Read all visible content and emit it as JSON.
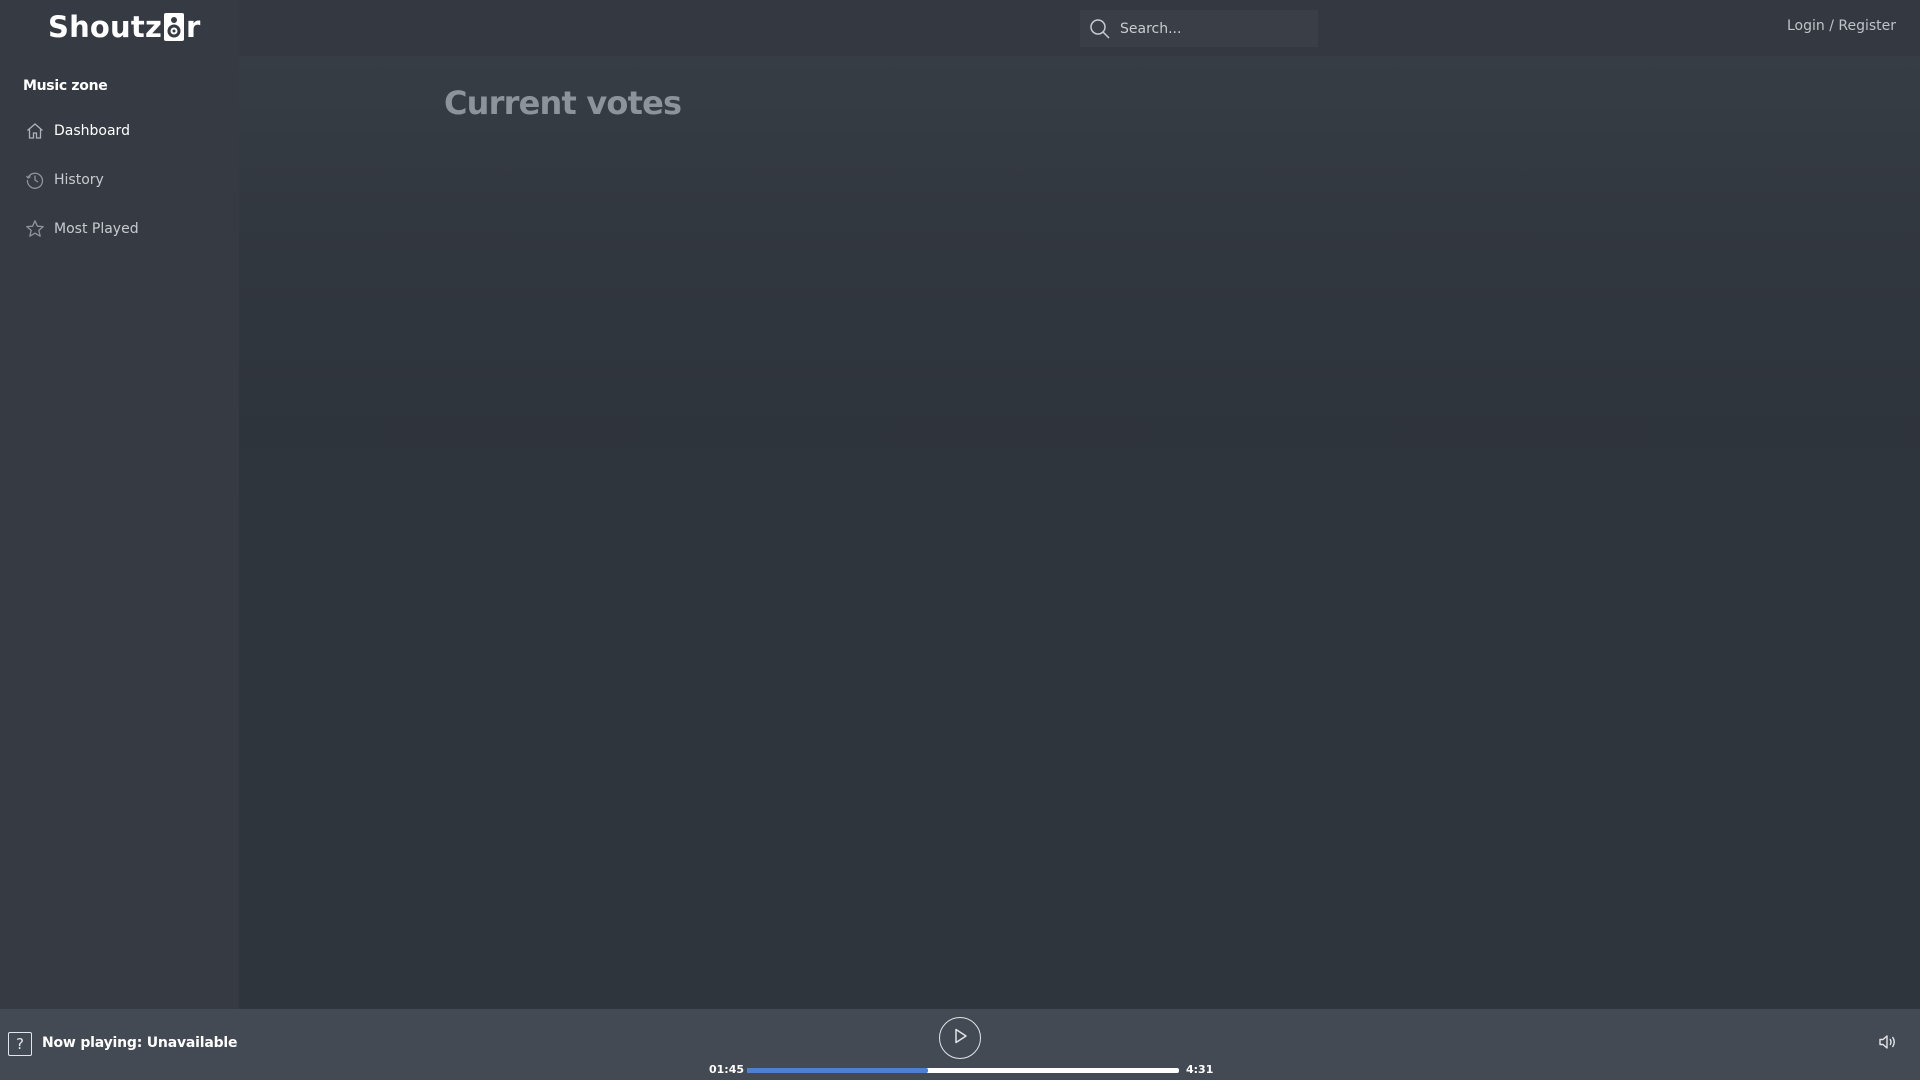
{
  "app": {
    "logo_text_start": "Shoutz",
    "logo_text_end": "r",
    "logo_icon": "speaker-icon"
  },
  "sidebar": {
    "section_title": "Music zone",
    "items": [
      {
        "label": "Dashboard",
        "icon": "home-icon",
        "active": true
      },
      {
        "label": "History",
        "icon": "history-icon",
        "active": false
      },
      {
        "label": "Most Played",
        "icon": "star-icon",
        "active": false
      }
    ]
  },
  "header": {
    "search_placeholder": "Search...",
    "login_label": "Login / Register"
  },
  "main": {
    "title": "Current votes"
  },
  "player": {
    "now_playing": "Now playing: Unavailable",
    "track_icon": "question-icon",
    "current_time": "01:45",
    "total_time": "4:31",
    "progress_fraction": 0.42,
    "play_icon": "play-icon",
    "volume_icon": "volume-icon"
  },
  "colors": {
    "accent": "#4f7fd1",
    "sidebar_bg": "#363b43",
    "player_bg": "#444a53",
    "main_bg": "#2f353d"
  }
}
